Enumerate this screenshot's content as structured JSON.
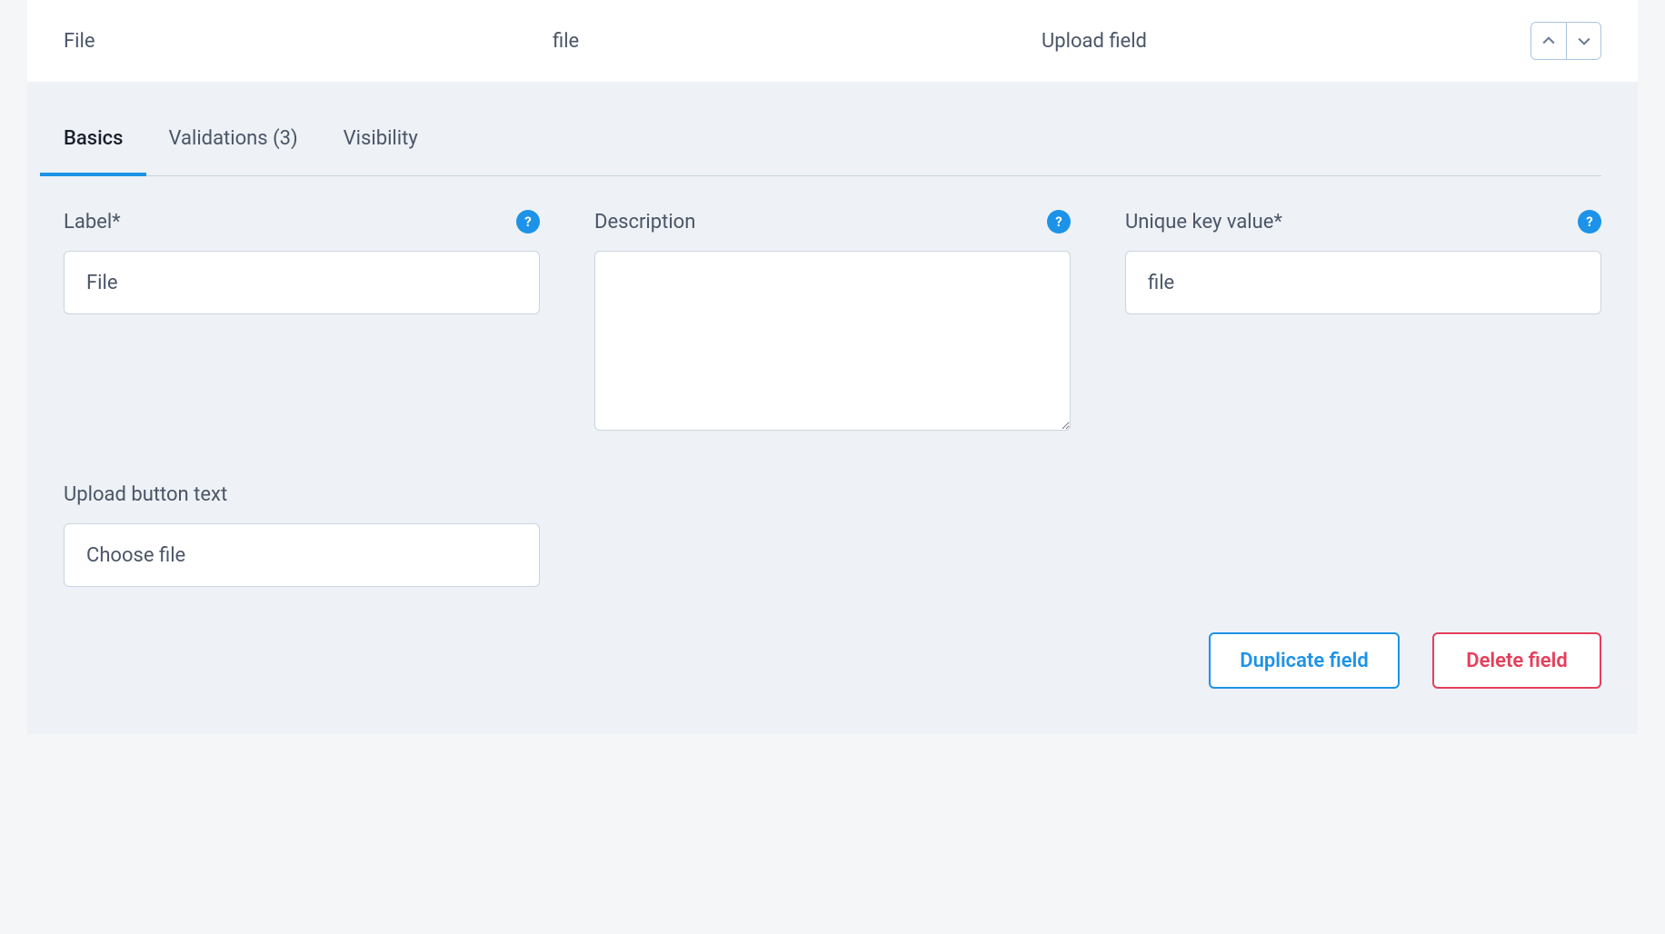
{
  "header": {
    "col1": "File",
    "col2": "file",
    "col3": "Upload field"
  },
  "tabs": {
    "basics": "Basics",
    "validations": "Validations (3)",
    "visibility": "Visibility"
  },
  "fields": {
    "label": {
      "label": "Label*",
      "value": "File"
    },
    "description": {
      "label": "Description",
      "value": ""
    },
    "unique_key": {
      "label": "Unique key value*",
      "value": "file"
    },
    "upload_button_text": {
      "label": "Upload button text",
      "value": "Choose file"
    }
  },
  "help_icon": "?",
  "buttons": {
    "duplicate": "Duplicate field",
    "delete": "Delete field"
  }
}
